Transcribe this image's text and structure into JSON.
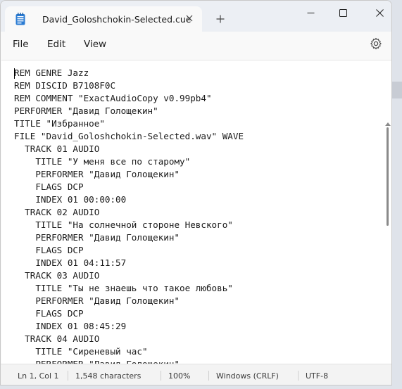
{
  "window": {
    "tab_title": "David_Goloshchokin-Selected.cue"
  },
  "menu": {
    "file": "File",
    "edit": "Edit",
    "view": "View"
  },
  "editor": {
    "lines": [
      "REM GENRE Jazz",
      "REM DISCID B7108F0C",
      "REM COMMENT \"ExactAudioCopy v0.99pb4\"",
      "PERFORMER \"Давид Голощекин\"",
      "TITLE \"Избранное\"",
      "FILE \"David_Goloshchokin-Selected.wav\" WAVE",
      "  TRACK 01 AUDIO",
      "    TITLE \"У меня все по старому\"",
      "    PERFORMER \"Давид Голощекин\"",
      "    FLAGS DCP",
      "    INDEX 01 00:00:00",
      "  TRACK 02 AUDIO",
      "    TITLE \"На солнечной стороне Невского\"",
      "    PERFORMER \"Давид Голощекин\"",
      "    FLAGS DCP",
      "    INDEX 01 04:11:57",
      "  TRACK 03 AUDIO",
      "    TITLE \"Ты не знаешь что такое любовь\"",
      "    PERFORMER \"Давид Голощекин\"",
      "    FLAGS DCP",
      "    INDEX 01 08:45:29",
      "  TRACK 04 AUDIO",
      "    TITLE \"Сиреневый час\"",
      "    PERFORMER \"Давид Голощекин\""
    ]
  },
  "status": {
    "position": "Ln 1, Col 1",
    "characters": "1,548 characters",
    "zoom": "100%",
    "line_ending": "Windows (CRLF)",
    "encoding": "UTF-8"
  },
  "icons": {
    "app": "notepad-icon",
    "close_tab": "close-icon",
    "new_tab": "plus-icon",
    "minimize": "minimize-icon",
    "maximize": "maximize-icon",
    "close_window": "close-icon",
    "settings": "gear-icon"
  },
  "colors": {
    "titlebar_bg": "#eceff4",
    "editor_bg": "#ffffff",
    "statusbar_bg": "#f3f3f3",
    "app_icon_blue": "#2b7cd3"
  }
}
